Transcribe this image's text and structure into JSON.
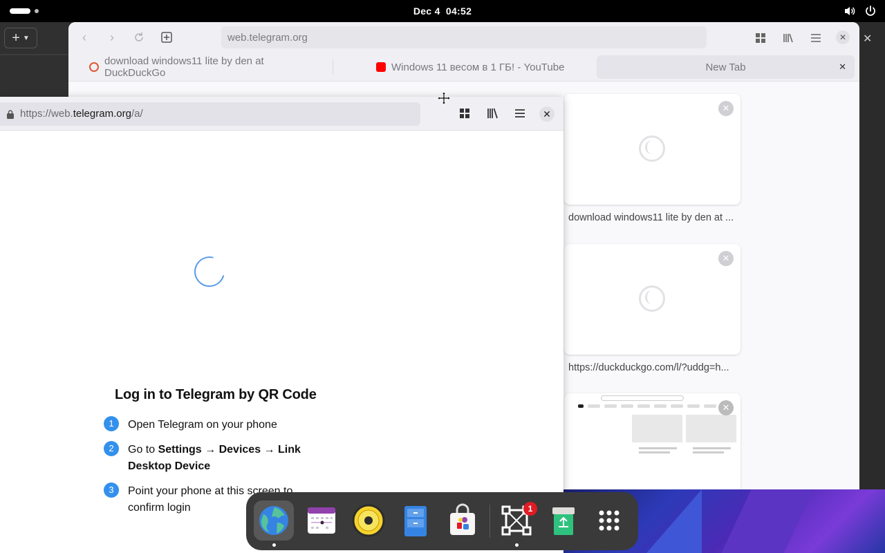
{
  "topbar": {
    "date": "Dec 4",
    "time": "04:52"
  },
  "browser": {
    "url_back": "web.telegram.org",
    "tabs": [
      {
        "label": "download windows11 lite by den at DuckDuckGo"
      },
      {
        "label": "Windows 11 весом в 1 ГБ! - YouTube"
      },
      {
        "label": "New Tab"
      }
    ],
    "tiles": [
      {
        "label": "download windows11 lite by den at ..."
      },
      {
        "label": "https://duckduckgo.com/l/?uddg=h..."
      }
    ]
  },
  "popup": {
    "url_prefix": "https://web.",
    "url_domain": "telegram.org",
    "url_path": "/a/",
    "login_title": "Log in to Telegram by QR Code",
    "steps": [
      {
        "num": "1",
        "text": "Open Telegram on your phone"
      },
      {
        "num": "2",
        "pre": "Go to ",
        "settings": "Settings",
        "arrow1": " → ",
        "devices": "Devices",
        "arrow2": " → ",
        "link": "Link Desktop Device"
      },
      {
        "num": "3",
        "text": "Point your phone at this screen to confirm login"
      }
    ]
  },
  "dock": {
    "badge_count": "1"
  },
  "colors": {
    "telegram_blue": "#3390ec",
    "spinner": "#5a9be8"
  }
}
